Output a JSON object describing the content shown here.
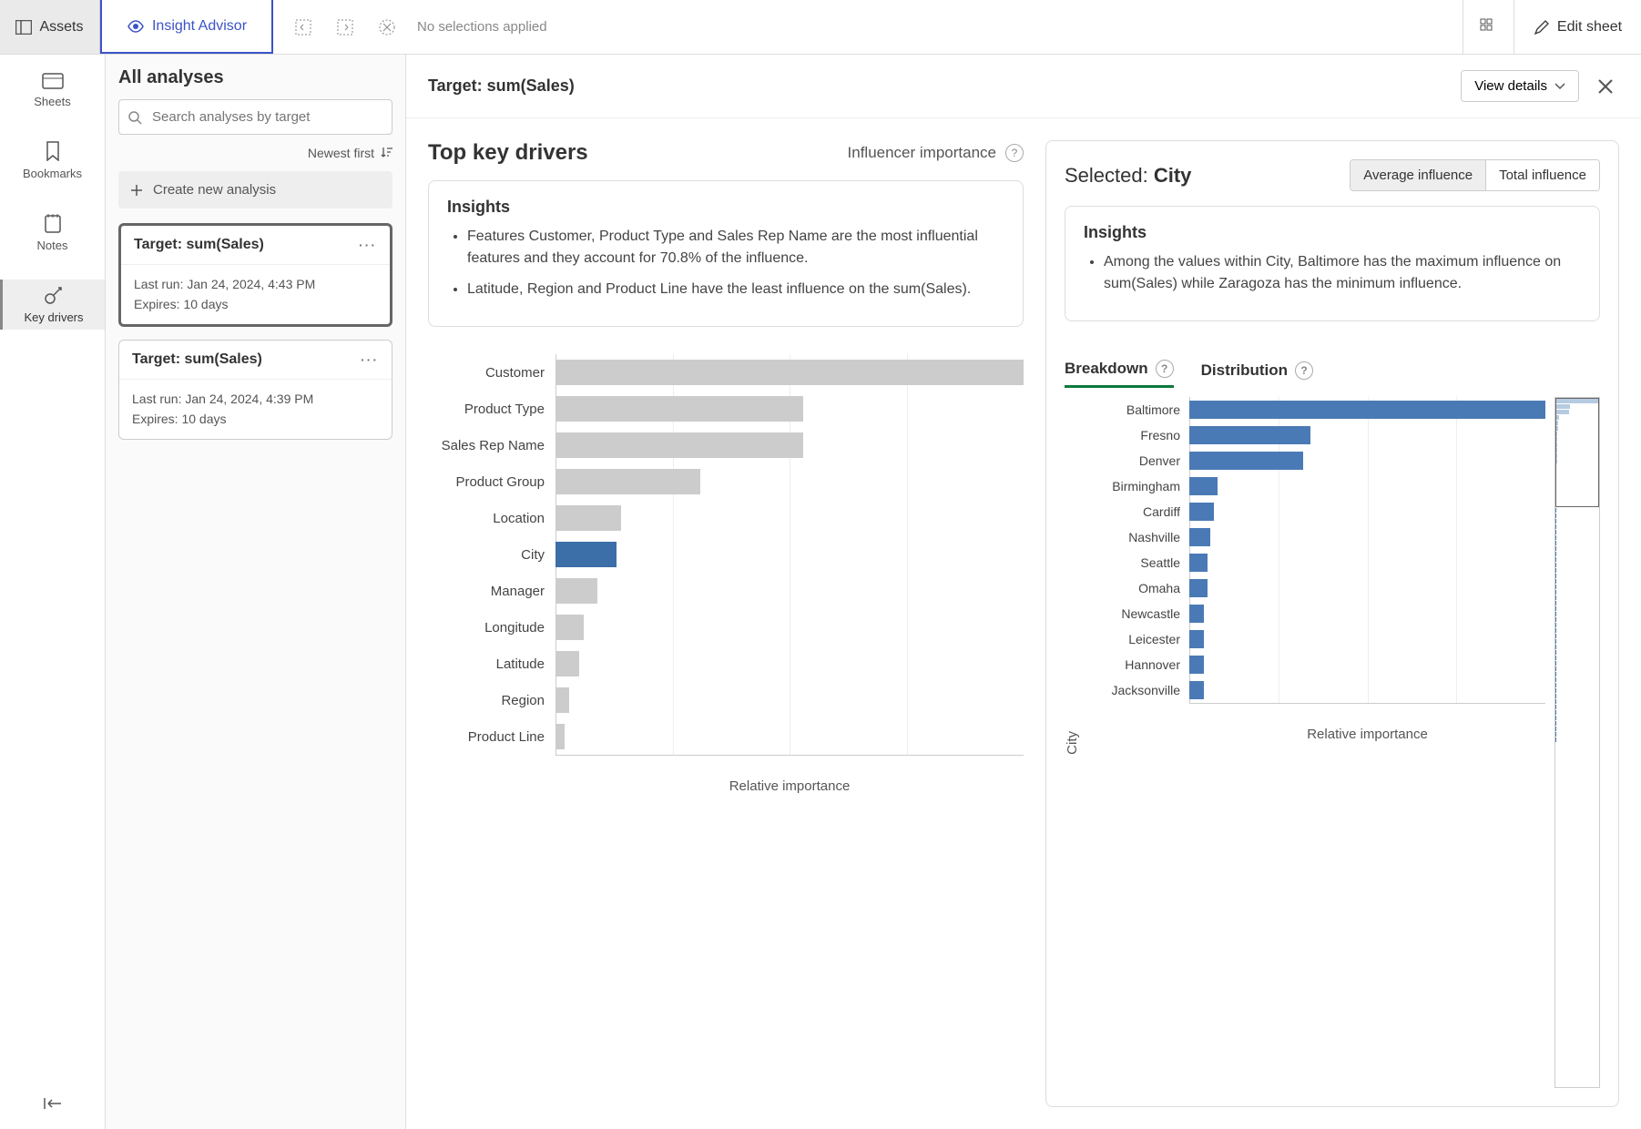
{
  "toolbar": {
    "assets": "Assets",
    "insight": "Insight Advisor",
    "no_selections": "No selections applied",
    "edit_sheet": "Edit sheet"
  },
  "rail": {
    "sheets": "Sheets",
    "bookmarks": "Bookmarks",
    "notes": "Notes",
    "key_drivers": "Key drivers"
  },
  "analyses": {
    "title": "All analyses",
    "search_placeholder": "Search analyses by target",
    "sort": "Newest first",
    "create": "Create new analysis",
    "cards": [
      {
        "title": "Target: sum(Sales)",
        "last_run": "Last run: Jan 24, 2024, 4:43 PM",
        "expires": "Expires: 10 days",
        "selected": true
      },
      {
        "title": "Target: sum(Sales)",
        "last_run": "Last run: Jan 24, 2024, 4:39 PM",
        "expires": "Expires: 10 days",
        "selected": false
      }
    ]
  },
  "content": {
    "target_label": "Target: sum(Sales)",
    "view_details": "View details"
  },
  "drivers": {
    "title": "Top key drivers",
    "subtitle": "Influencer importance",
    "insights_title": "Insights",
    "insights": [
      "Features Customer, Product Type and Sales Rep Name are the most influential features and they account for 70.8% of the influence.",
      "Latitude, Region and Product Line have the least influence on the sum(Sales)."
    ],
    "x_label": "Relative importance"
  },
  "selected_panel": {
    "prefix": "Selected: ",
    "dimension": "City",
    "avg_influence": "Average influence",
    "total_influence": "Total influence",
    "insights_title": "Insights",
    "insight_text": "Among the values within City, Baltimore has the maximum influence on sum(Sales) while Zaragoza has the minimum influence.",
    "tab_breakdown": "Breakdown",
    "tab_distribution": "Distribution",
    "y_label": "City",
    "x_label": "Relative importance"
  },
  "chart_data": [
    {
      "type": "bar",
      "orientation": "horizontal",
      "title": "Top key drivers — Influencer importance",
      "xlabel": "Relative importance",
      "ylabel": "",
      "categories": [
        "Customer",
        "Product Type",
        "Sales Rep Name",
        "Product Group",
        "Location",
        "City",
        "Manager",
        "Longitude",
        "Latitude",
        "Region",
        "Product Line"
      ],
      "values": [
        100,
        53,
        53,
        31,
        14,
        13,
        9,
        6,
        5,
        3,
        2
      ],
      "highlight": "City"
    },
    {
      "type": "bar",
      "orientation": "horizontal",
      "title": "Breakdown — City average influence",
      "xlabel": "Relative importance",
      "ylabel": "City",
      "categories": [
        "Baltimore",
        "Fresno",
        "Denver",
        "Birmingham",
        "Cardiff",
        "Nashville",
        "Seattle",
        "Omaha",
        "Newcastle",
        "Leicester",
        "Hannover",
        "Jacksonville"
      ],
      "values": [
        100,
        34,
        32,
        8,
        7,
        6,
        5,
        5,
        4,
        4,
        4,
        4
      ]
    }
  ]
}
